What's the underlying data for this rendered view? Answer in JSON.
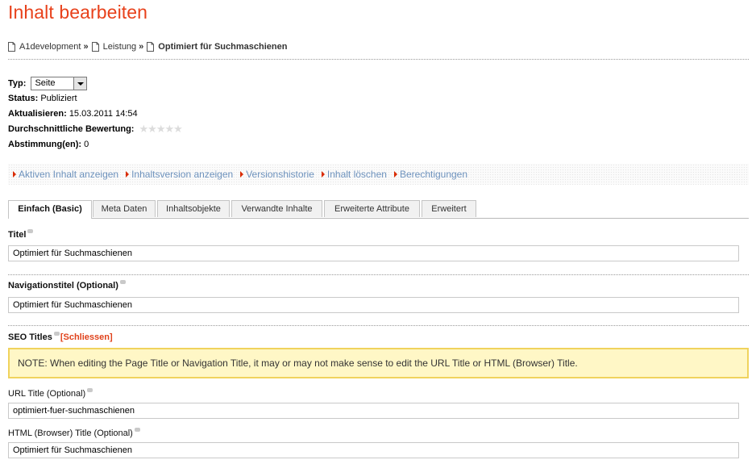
{
  "page": {
    "title": "Inhalt bearbeiten"
  },
  "breadcrumb": {
    "items": [
      "A1development",
      "Leistung",
      "Optimiert für Suchmaschienen"
    ],
    "separator": "»"
  },
  "meta": {
    "typ_label": "Typ:",
    "typ_value": "Seite",
    "status_label": "Status:",
    "status_value": "Publiziert",
    "updated_label": "Aktualisieren:",
    "updated_value": "15.03.2011 14:54",
    "rating_label": "Durchschnittliche Bewertung:",
    "rating_stars": "★★★★★",
    "rating_value": 0,
    "votes_label": "Abstimmung(en):",
    "votes_value": "0"
  },
  "actions": [
    "Aktiven Inhalt anzeigen",
    "Inhaltsversion anzeigen",
    "Versionshistorie",
    "Inhalt löschen",
    "Berechtigungen"
  ],
  "tabs": [
    "Einfach (Basic)",
    "Meta Daten",
    "Inhaltsobjekte",
    "Verwandte Inhalte",
    "Erweiterte Attribute",
    "Erweitert"
  ],
  "active_tab": "Einfach (Basic)",
  "form": {
    "titel_label": "Titel",
    "titel_value": "Optimiert für Suchmaschienen",
    "navtitel_label": "Navigationstitel (Optional)",
    "navtitel_value": "Optimiert für Suchmaschienen",
    "seo_label": "SEO Titles",
    "seo_close": "[Schliessen]",
    "note": "NOTE: When editing the Page Title or Navigation Title, it may or may not make sense to edit the URL Title or HTML (Browser) Title.",
    "url_label": "URL Title (Optional)",
    "url_value": "optimiert-fuer-suchmaschienen",
    "html_label": "HTML (Browser) Title (Optional)",
    "html_value": "Optimiert für Suchmaschienen"
  },
  "colors": {
    "title": "#e8411b",
    "link": "#6d92bd",
    "link_arrow": "#d92b00",
    "note_bg": "#fff7c6",
    "note_border": "#f0d35d"
  }
}
